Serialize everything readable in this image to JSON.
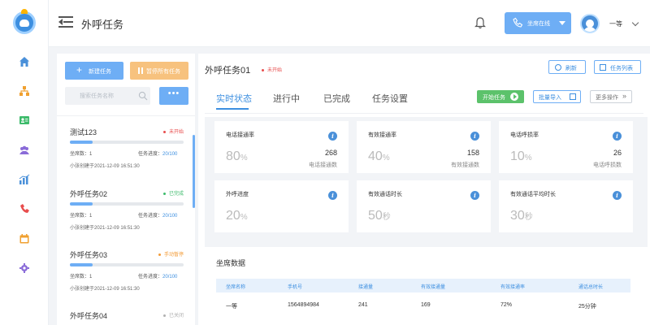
{
  "header": {
    "title": "外呼任务",
    "agent_status": "坐席在线",
    "user_name": "一等"
  },
  "task_list": {
    "new_label": "新建任务",
    "pause_all_label": "暂停所有任务",
    "search_placeholder": "搜索任务名称",
    "more_label": "•••",
    "items": [
      {
        "name": "测试123",
        "status": "未开始",
        "status_color": "#e84d4d",
        "progress": 0.2,
        "agents_label": "坐席数：1",
        "progress_label": "任务进度：",
        "progress_value": "20/100",
        "created": "小张创建于2021-12-09 16:51:30"
      },
      {
        "name": "外呼任务02",
        "status": "已完成",
        "status_color": "#3dbb6b",
        "progress": 0.2,
        "agents_label": "坐席数：1",
        "progress_label": "任务进度：",
        "progress_value": "20/100",
        "created": "小张创建于2021-12-09 16:51:30"
      },
      {
        "name": "外呼任务03",
        "status": "手动暂停",
        "status_color": "#f39c38",
        "progress": 0.2,
        "agents_label": "坐席数：1",
        "progress_label": "任务进度：",
        "progress_value": "20/100",
        "created": "小张创建于2021-12-09 16:51:30"
      },
      {
        "name": "外呼任务04",
        "status": "已关闭",
        "status_color": "#b0b0b0",
        "progress": 0.2,
        "agents_label": "",
        "progress_label": "",
        "progress_value": "",
        "created": ""
      }
    ]
  },
  "main": {
    "title": "外呼任务01",
    "status": "未开始",
    "refresh_label": "刷新",
    "task_list_label": "任务列表",
    "tabs": [
      {
        "label": "实时状态",
        "active": true
      },
      {
        "label": "进行中",
        "active": false
      },
      {
        "label": "已完成",
        "active": false
      },
      {
        "label": "任务设置",
        "active": false
      }
    ],
    "start_label": "开始任务",
    "import_label": "批量导入",
    "more_ops_label": "更多操作",
    "metrics": [
      {
        "title": "电话接通率",
        "value": "80",
        "unit": "%",
        "count": "268",
        "count_label": "电话接通数"
      },
      {
        "title": "有效接通率",
        "value": "40",
        "unit": "%",
        "count": "158",
        "count_label": "有效接通数"
      },
      {
        "title": "电话呼损率",
        "value": "10",
        "unit": "%",
        "count": "26",
        "count_label": "电话呼损数"
      },
      {
        "title": "外呼进度",
        "value": "20",
        "unit": "%",
        "count": "",
        "count_label": ""
      },
      {
        "title": "有效通话时长",
        "value": "50",
        "unit": "秒",
        "count": "",
        "count_label": ""
      },
      {
        "title": "有效通话平均时长",
        "value": "30",
        "unit": "秒",
        "count": "",
        "count_label": ""
      }
    ],
    "agents_section_title": "坐席数据",
    "agents_table": {
      "headers": [
        "坐席名称",
        "手机号",
        "接通量",
        "有效接通量",
        "有效接通率",
        "通话总时长"
      ],
      "rows": [
        [
          "一等",
          "1564894984",
          "241",
          "169",
          "72%",
          "25分钟"
        ]
      ]
    }
  },
  "icons": {
    "rail": [
      "home-icon",
      "org-chart-icon",
      "contact-card-icon",
      "users-group-icon",
      "bar-chart-icon",
      "phone-tools-icon",
      "calendar-icon",
      "gear-icon"
    ],
    "accent": "#3d8fe0"
  }
}
